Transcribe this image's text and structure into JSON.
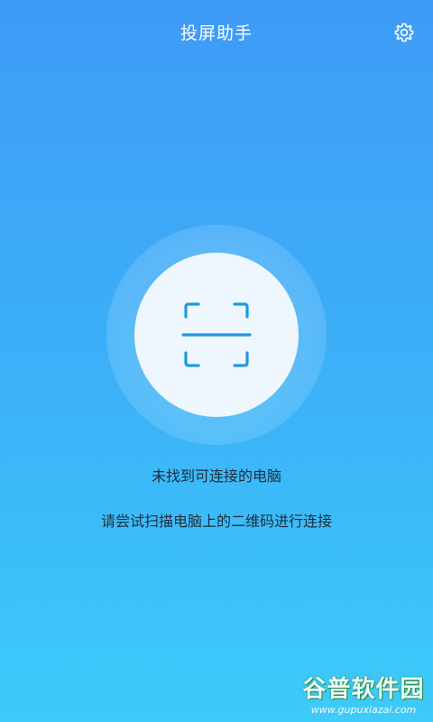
{
  "header": {
    "title": "投屏助手",
    "settings_icon": "gear-icon"
  },
  "scan": {
    "icon": "scan-qr-icon",
    "accent_color": "#1f9ae0"
  },
  "status": {
    "message": "未找到可连接的电脑",
    "hint": "请尝试扫描电脑上的二维码进行连接"
  },
  "watermark": {
    "logo_text": "谷普软件园",
    "url": "www.gupuxiazai.com"
  }
}
